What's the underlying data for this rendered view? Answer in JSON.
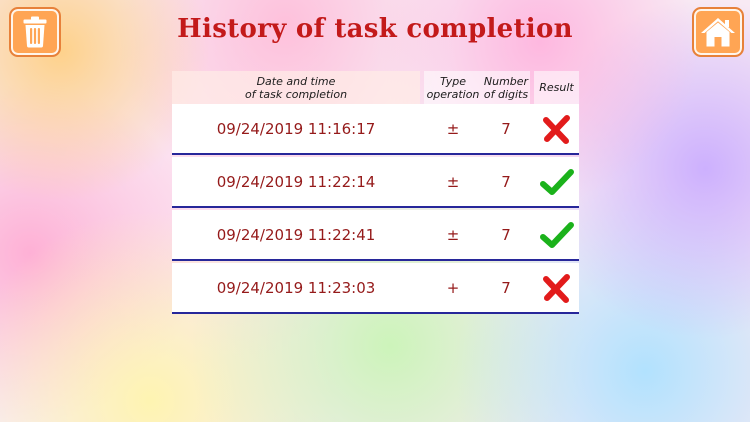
{
  "title": "History of task completion",
  "toolbar": {
    "delete_icon": "trash-icon",
    "home_icon": "home-icon",
    "accent_color": "#ffa554"
  },
  "table": {
    "headers": {
      "date_line1": "Date and time",
      "date_line2": "of task completion",
      "type_line1": "Type",
      "type_line2": "operation",
      "digits_line1": "Number",
      "digits_line2": "of digits",
      "result": "Result"
    },
    "rows": [
      {
        "datetime": "09/24/2019 11:16:17",
        "operation": "±",
        "digits": "7",
        "result": "fail"
      },
      {
        "datetime": "09/24/2019 11:22:14",
        "operation": "±",
        "digits": "7",
        "result": "success"
      },
      {
        "datetime": "09/24/2019 11:22:41",
        "operation": "±",
        "digits": "7",
        "result": "success"
      },
      {
        "datetime": "09/24/2019 11:23:03",
        "operation": "+",
        "digits": "7",
        "result": "fail"
      }
    ]
  },
  "colors": {
    "title": "#c31a1a",
    "row_text": "#951a1a",
    "row_divider": "#27279a",
    "success": "#1bb21b",
    "fail": "#e21b1b"
  }
}
